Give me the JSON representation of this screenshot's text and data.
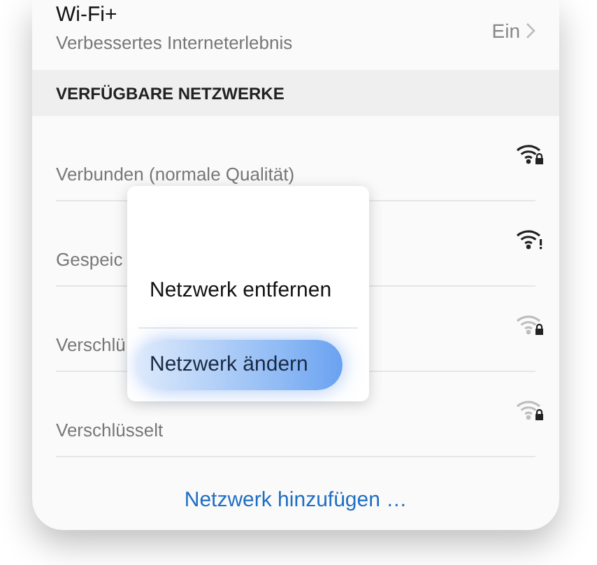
{
  "wifi_plus": {
    "title": "Wi-Fi+",
    "subtitle": "Verbessertes Interneterlebnis",
    "value": "Ein"
  },
  "section_header": "VERFÜGBARE NETZWERKE",
  "networks": [
    {
      "status": "Verbunden (normale Qualität)",
      "strong": true,
      "kind": "locked"
    },
    {
      "status": "Gespeic",
      "strong": true,
      "kind": "warning"
    },
    {
      "status": "Verschlü",
      "strong": false,
      "kind": "locked"
    },
    {
      "status": "Verschlüsselt",
      "strong": false,
      "kind": "locked"
    }
  ],
  "context_menu": {
    "items": [
      {
        "label": "Netzwerk entfernen",
        "selected": false
      },
      {
        "label": "Netzwerk ändern",
        "selected": true
      }
    ]
  },
  "add_network": "Netzwerk hinzufügen …"
}
